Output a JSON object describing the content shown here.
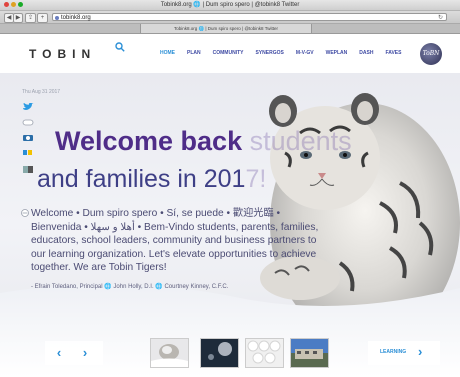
{
  "window": {
    "title": "Tobink8.org 🌐 | Dum spiro spero | @tobink8 Twitter",
    "url": "tobink8.org",
    "tab_title": "Tobink8.org 🌐 | Dum spiro spero | @tobink8 Twitter"
  },
  "header": {
    "logo_text": "TOBIN",
    "nav": [
      "HOME",
      "PLAN",
      "COMMUNITY",
      "SYNERGOS",
      "M-V-GV",
      "WEPLAN",
      "DASH",
      "FAVES"
    ],
    "active_nav": "HOME",
    "badge_text": "ToBN"
  },
  "hero": {
    "date": "Thu Aug 31 2017",
    "headline_main": "Welcome back",
    "headline_faded": " students",
    "headline2_main": "and families in 201",
    "headline2_faded": "7!",
    "welcome_text": "Welcome • Dum spiro spero • Sí, se puede • 歡迎光臨 • Bienvenida • أهلا و سهلا • Bem-Vindo students, parents, families, educators, school leaders, community and business partners to our learning organization. Let's elevate opportunities to achieve together. We are Tobin Tigers!",
    "credits": "- Efrain Toledano, Principal 🌐 John Holly, D.I. 🌐 Courtney Kinney, C.F.C.",
    "learning_label": "LEARNING"
  },
  "colors": {
    "headline_purple": "#4f2d88",
    "nav_blue": "#3e4aa3",
    "accent_blue": "#2b8fd6"
  }
}
